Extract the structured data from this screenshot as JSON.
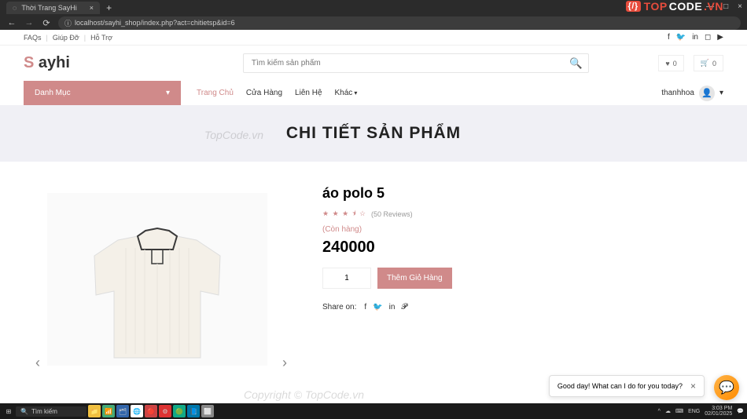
{
  "browser": {
    "tab_title": "Thời Trang SayHi",
    "url": "localhost/sayhi_shop/index.php?act=chitietsp&id=6"
  },
  "topcode_brand": {
    "prefix": "TOP",
    "mid": "CODE",
    "suffix": ".VN",
    "icon": "{/}"
  },
  "util": {
    "faqs": "FAQs",
    "help": "Giúp Đỡ",
    "support": "Hỗ Trợ"
  },
  "logo": {
    "first": "S",
    "rest": " ayhi"
  },
  "search": {
    "placeholder": "Tìm kiếm sản phẩm"
  },
  "counters": {
    "wishlist": "0",
    "cart": "0"
  },
  "category_label": "Danh Mục",
  "nav": {
    "home": "Trang Chủ",
    "shop": "Cửa Hàng",
    "contact": "Liên Hệ",
    "other": "Khác"
  },
  "user": {
    "name": "thanhhoa"
  },
  "page_title": "CHI TIẾT SẢN PHẨM",
  "watermark": "TopCode.vn",
  "watermark2": "Copyright © TopCode.vn",
  "product": {
    "name": "áo polo 5",
    "reviews_text": "(50 Reviews)",
    "stock": "(Còn hàng)",
    "price": "240000",
    "qty": "1",
    "add_to_cart": "Thêm Giỏ Hàng",
    "share_label": "Share on:"
  },
  "chat": {
    "message": "Good day! What can I do for you today?"
  },
  "taskbar": {
    "search": "Tìm kiếm",
    "time": "3:03 PM",
    "date": "02/01/2025",
    "lang": "ENG"
  }
}
